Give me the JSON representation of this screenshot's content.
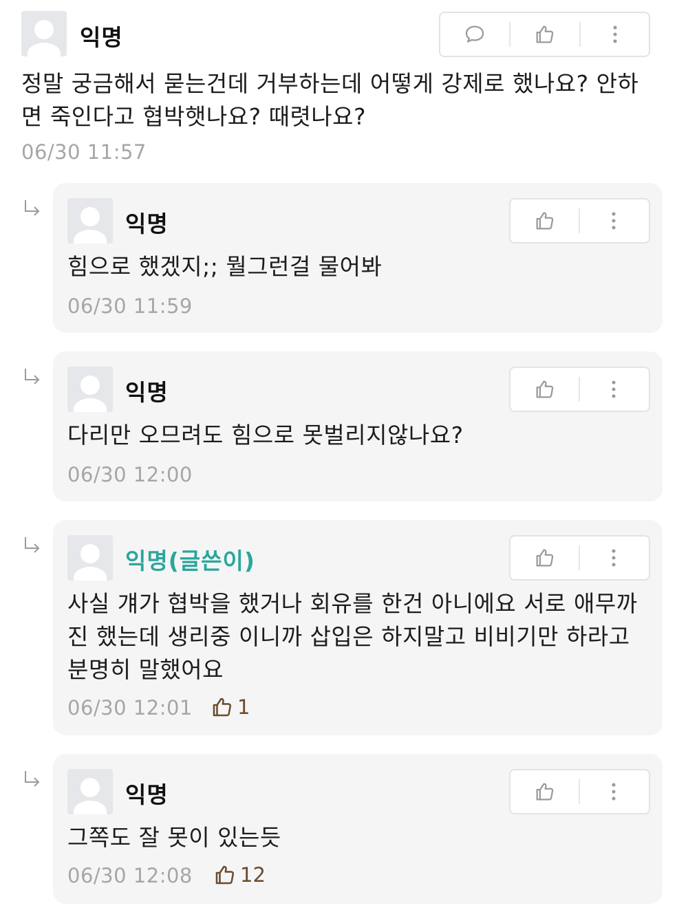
{
  "main_post": {
    "nickname": "익명",
    "text": "정말 궁금해서 묻는건데 거부하는데 어떻게 강제로 했나요? 안하면 죽인다고 협박햇나요? 때렷나요?",
    "time": "06/30 11:57"
  },
  "replies": [
    {
      "nickname": "익명",
      "text": "힘으로 했겠지;; 뭘그런걸 물어봐",
      "time": "06/30 11:59",
      "likes": ""
    },
    {
      "nickname": "익명",
      "text": "다리만 오므려도 힘으로 못벌리지않나요?",
      "time": "06/30 12:00",
      "likes": ""
    },
    {
      "nickname": "익명(글쓴이)",
      "text": "사실 걔가 협박을 했거나 회유를 한건 아니에요 서로 애무까진 했는데 생리중 이니까 삽입은 하지말고 비비기만 하라고 분명히 말했어요",
      "time": "06/30 12:01",
      "likes": "1"
    },
    {
      "nickname": "익명",
      "text": "그쪽도 잘 못이 있는듯",
      "time": "06/30 12:08",
      "likes": "12"
    }
  ],
  "icons": {
    "comment": "speech-bubble-icon",
    "like": "thumbs-up-icon",
    "more": "vertical-dots-icon",
    "reply": "reply-arrow-icon"
  },
  "colors": {
    "author_nick": "#2aa69c",
    "like_count": "#6b4a2e",
    "timestamp": "#a6a6a6",
    "card_bg": "#f5f5f5"
  }
}
